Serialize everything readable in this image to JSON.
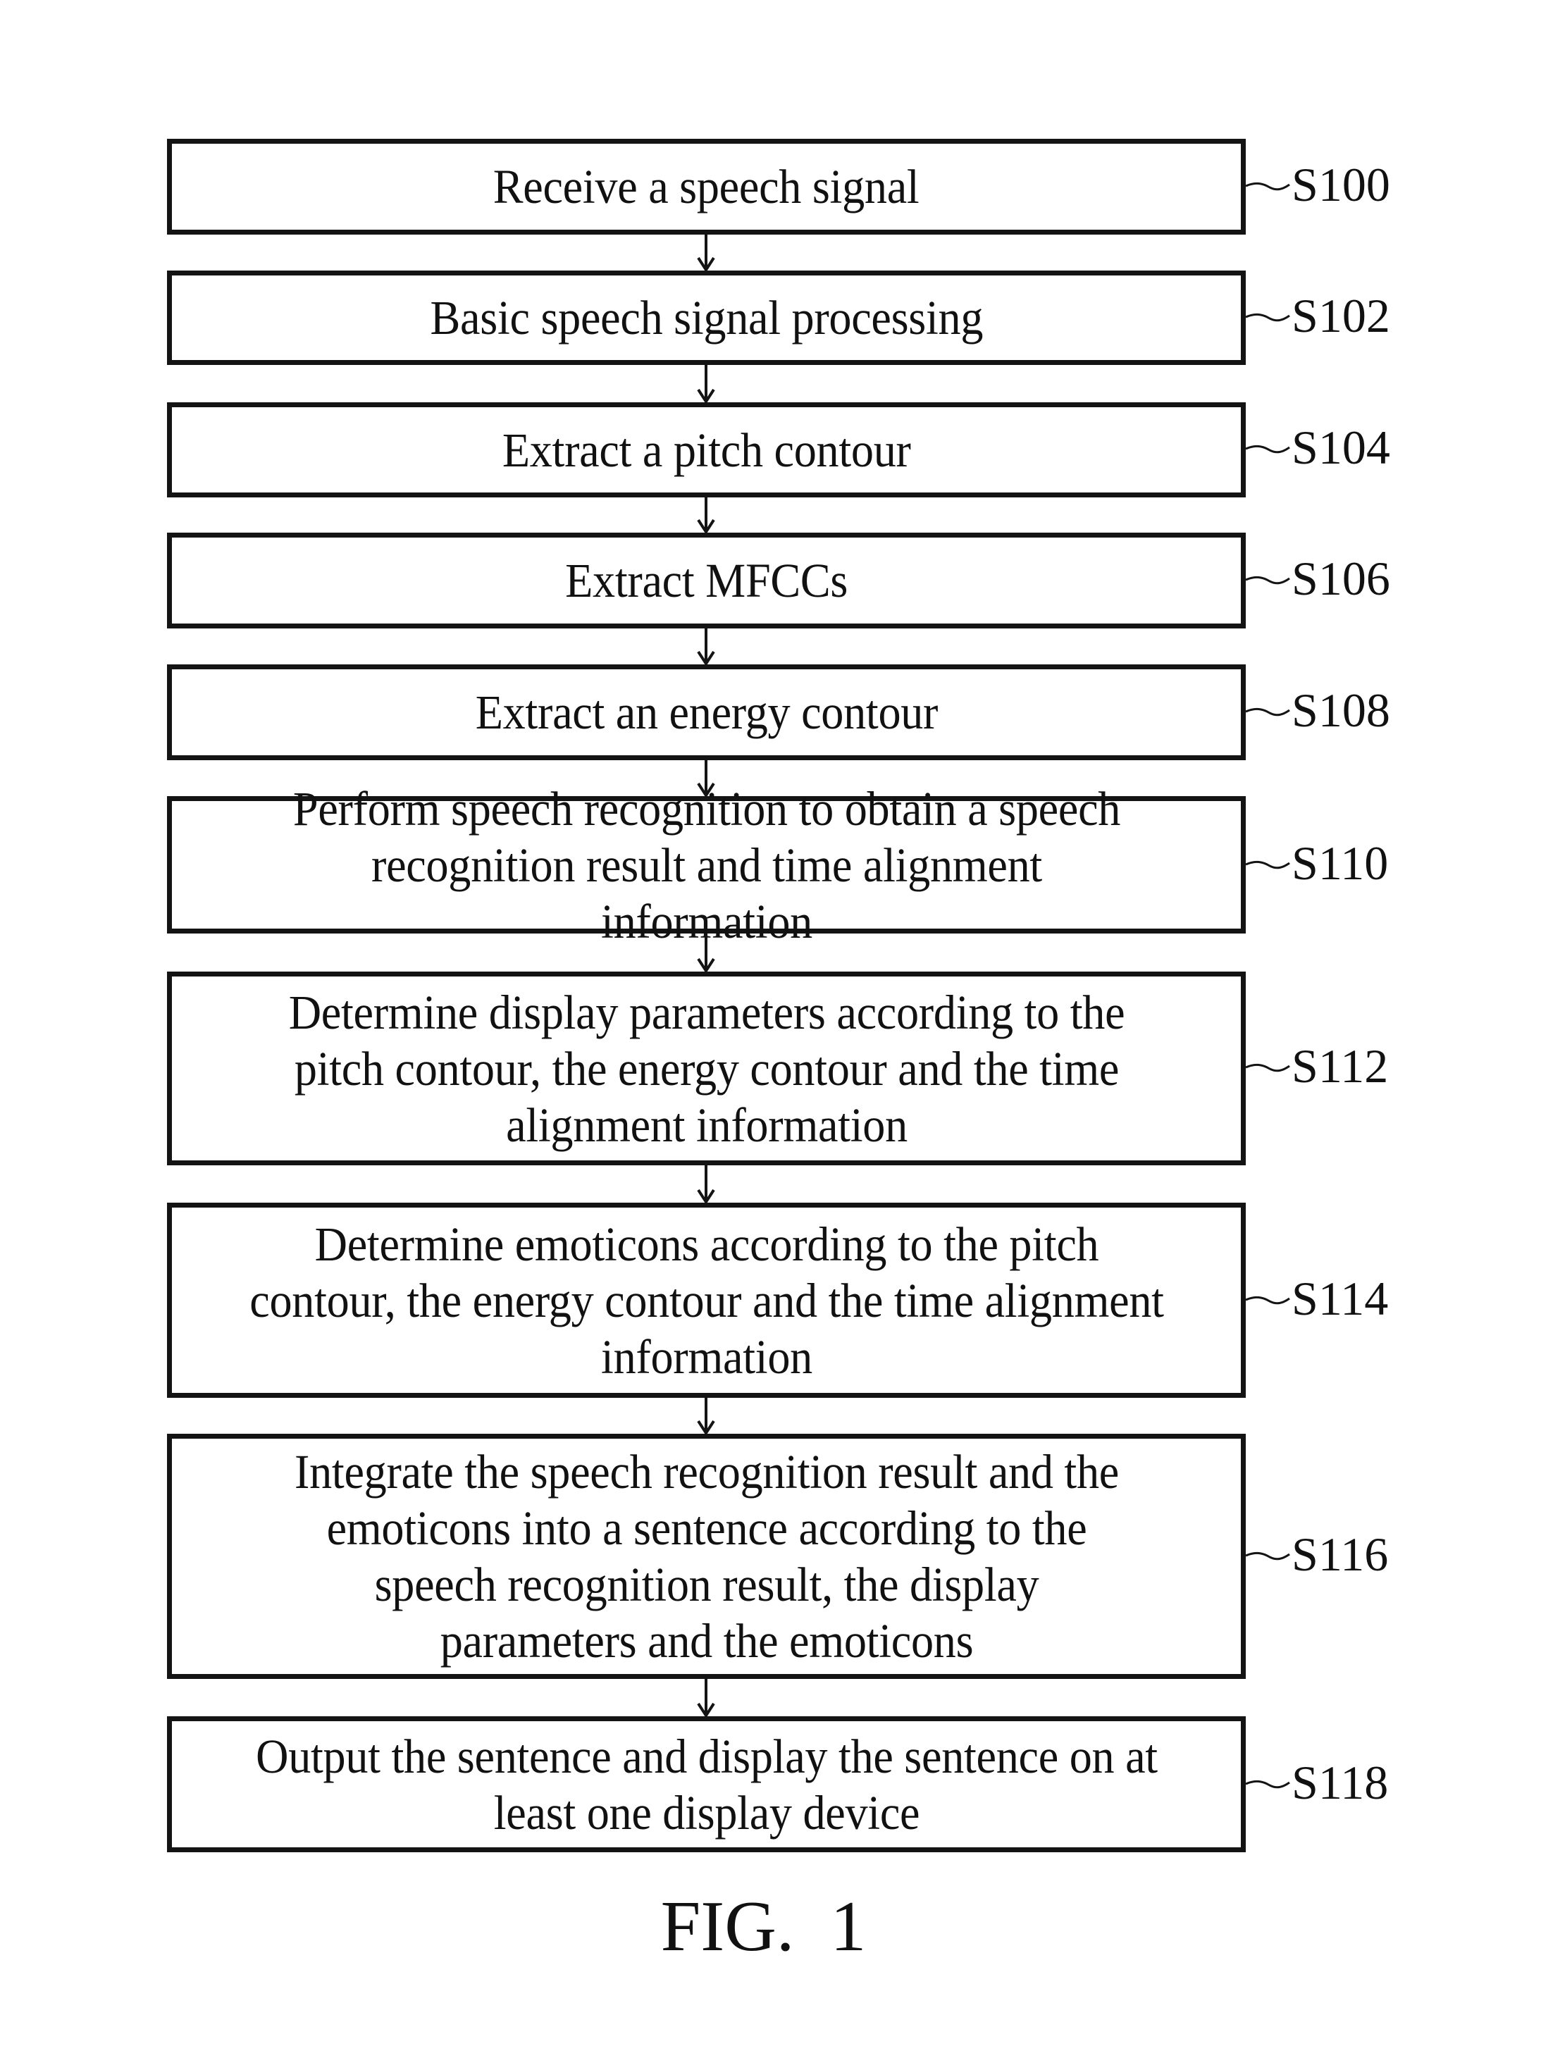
{
  "figure": {
    "caption": "FIG.  1",
    "steps": [
      {
        "id": "S100",
        "text": "Receive a speech signal"
      },
      {
        "id": "S102",
        "text": "Basic speech signal processing"
      },
      {
        "id": "S104",
        "text": "Extract a pitch contour"
      },
      {
        "id": "S106",
        "text": "Extract MFCCs"
      },
      {
        "id": "S108",
        "text": "Extract an energy contour"
      },
      {
        "id": "S110",
        "text": "Perform speech recognition to obtain a speech recognition result and time alignment information"
      },
      {
        "id": "S112",
        "text": "Determine display parameters according to the pitch contour, the energy contour and the time alignment information"
      },
      {
        "id": "S114",
        "text": "Determine emoticons according to the pitch contour, the energy contour and the time alignment information"
      },
      {
        "id": "S116",
        "text": "Integrate the speech recognition result and the emoticons into a sentence according to the speech recognition result, the display parameters and the emoticons"
      },
      {
        "id": "S118",
        "text": "Output the sentence and display the sentence on at least one display device"
      }
    ]
  }
}
